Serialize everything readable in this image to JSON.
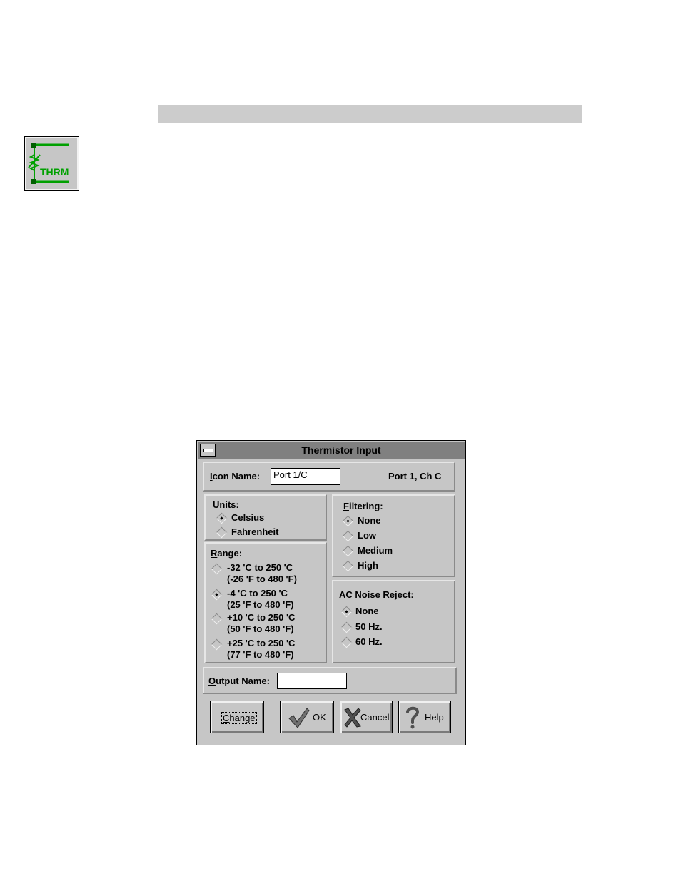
{
  "icon": {
    "label": "THRM"
  },
  "dialog": {
    "title": "Thermistor Input",
    "icon_name": {
      "label_first": "I",
      "label_rest": "con Name:",
      "value": "Port 1/C"
    },
    "port_info": "Port 1, Ch C",
    "units": {
      "label_first": "U",
      "label_rest": "nits:",
      "options": [
        "Celsius",
        "Fahrenheit"
      ],
      "selected": 0
    },
    "filtering": {
      "label_first": "F",
      "label_rest": "iltering:",
      "options": [
        "None",
        "Low",
        "Medium",
        "High"
      ],
      "selected": 0
    },
    "range": {
      "label_first": "R",
      "label_rest": "ange:",
      "options": [
        {
          "c": "-32 'C  to  250 'C",
          "f": "(-26 'F  to  480 'F)"
        },
        {
          "c": "-4 'C  to  250 'C",
          "f": "(25 'F  to  480 'F)"
        },
        {
          "c": "+10 'C  to  250 'C",
          "f": "(50 'F  to  480 'F)"
        },
        {
          "c": "+25 'C  to  250 'C",
          "f": "(77 'F  to  480 'F)"
        }
      ],
      "selected": 1
    },
    "noise_reject": {
      "label_pre": "AC ",
      "label_first": "N",
      "label_rest": "oise Reject:",
      "options": [
        "None",
        "50 Hz.",
        "60 Hz."
      ],
      "selected": 0
    },
    "output_name": {
      "label_first": "O",
      "label_rest": "utput Name:",
      "value": ""
    },
    "buttons": {
      "change_first": "C",
      "change_rest": "hange",
      "ok": "OK",
      "cancel": "Cancel",
      "help": "Help"
    }
  }
}
